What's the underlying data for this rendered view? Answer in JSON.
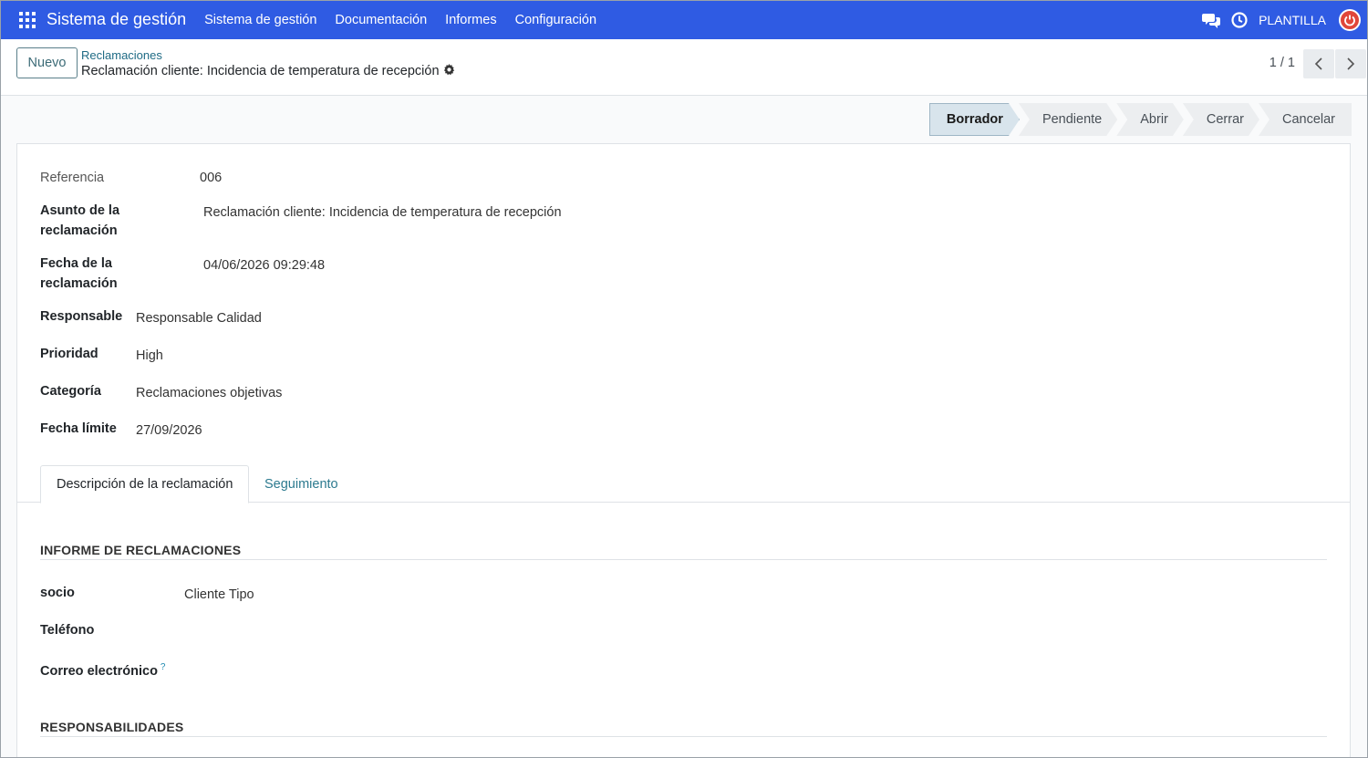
{
  "navbar": {
    "brand": "Sistema de gestión",
    "menu": [
      "Sistema de gestión",
      "Documentación",
      "Informes",
      "Configuración"
    ],
    "company": "PLANTILLA"
  },
  "control_panel": {
    "new_button": "Nuevo",
    "breadcrumb_parent": "Reclamaciones",
    "breadcrumb_current": "Reclamación cliente: Incidencia de temperatura de recepción",
    "pager": "1 / 1"
  },
  "statusbar": {
    "stages": [
      "Borrador",
      "Pendiente",
      "Abrir",
      "Cerrar",
      "Cancelar"
    ],
    "active": "Borrador"
  },
  "form": {
    "referencia": {
      "label": "Referencia",
      "value": "006"
    },
    "asunto": {
      "label_line1": "Asunto de la",
      "label_line2": "reclamación",
      "value": "Reclamación cliente: Incidencia de temperatura de recepción"
    },
    "fecha": {
      "label_line1": "Fecha de la",
      "label_line2": "reclamación",
      "value": "04/06/2026 09:29:48"
    },
    "responsable": {
      "label": "Responsable",
      "value": "Responsable Calidad"
    },
    "prioridad": {
      "label": "Prioridad",
      "value": "High"
    },
    "categoria": {
      "label": "Categoría",
      "value": "Reclamaciones objetivas"
    },
    "fecha_limite": {
      "label": "Fecha límite",
      "value": "27/09/2026"
    }
  },
  "tabs": [
    "Descripción de la reclamación",
    "Seguimiento"
  ],
  "informe": {
    "title": "INFORME DE RECLAMACIONES",
    "socio": {
      "label": "socio",
      "value": "Cliente Tipo"
    },
    "telefono": {
      "label": "Teléfono",
      "value": ""
    },
    "correo": {
      "label": "Correo electrónico",
      "help": "?",
      "value": ""
    }
  },
  "responsabilidades": {
    "title": "RESPONSABILIDADES"
  }
}
